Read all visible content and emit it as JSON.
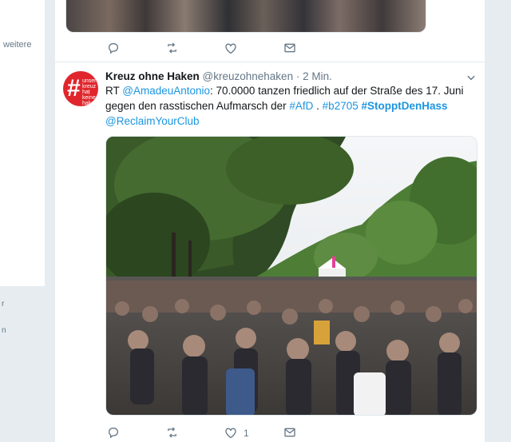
{
  "left": {
    "weitere": "weitere",
    "frag_r": "r",
    "frag_n": "n"
  },
  "tweet": {
    "name": "Kreuz ohne Haken",
    "handle": "@kreuzohnehaken",
    "separator": "·",
    "time": "2 Min.",
    "text_parts": {
      "rt": "RT ",
      "mention1": "@AmadeuAntonio",
      "body1": ": 70.0000 tanzen friedlich auf der Straße des 17. Juni gegen den rasstischen Aufmarsch der ",
      "hashtag1": "#AfD",
      "body2": " . ",
      "hashtag2": "#b2705",
      "space": " ",
      "hashtag3": "#StopptDenHass",
      "mention2": "@ReclaimYourClub"
    },
    "like_count": "1"
  },
  "avatar": {
    "symbol": "#",
    "lines": [
      "unser",
      "kreuz",
      "hat keine",
      "haken"
    ]
  },
  "icons": {
    "reply": "reply-icon",
    "retweet": "retweet-icon",
    "like": "heart-icon",
    "dm": "envelope-icon",
    "caret": "chevron-down-icon"
  },
  "colors": {
    "link": "#1b95e0",
    "avatar_bg": "#e0262c",
    "icon_grey": "#657786"
  }
}
